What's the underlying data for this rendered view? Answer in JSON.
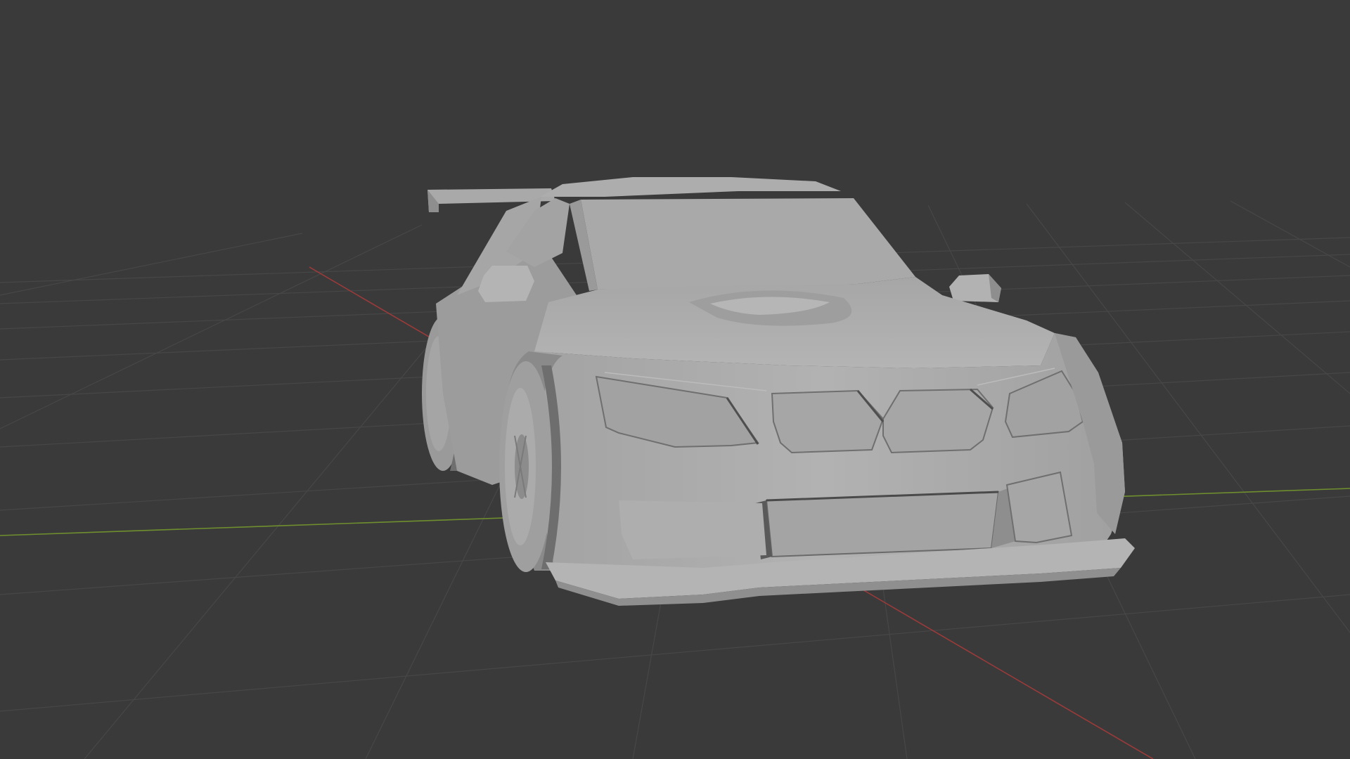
{
  "viewport": {
    "background": "#3a3a3a",
    "grid_color": "#4a4a4a",
    "x_axis_color": "#9b3a3a",
    "y_axis_color": "#6f8f2e"
  },
  "model": {
    "type": "car",
    "shading": "solid",
    "body_color": "#a8a8a8",
    "highlight_color": "#b9b9b9",
    "shadow_color": "#8e8e8e",
    "dark_color": "#7a7a7a"
  }
}
